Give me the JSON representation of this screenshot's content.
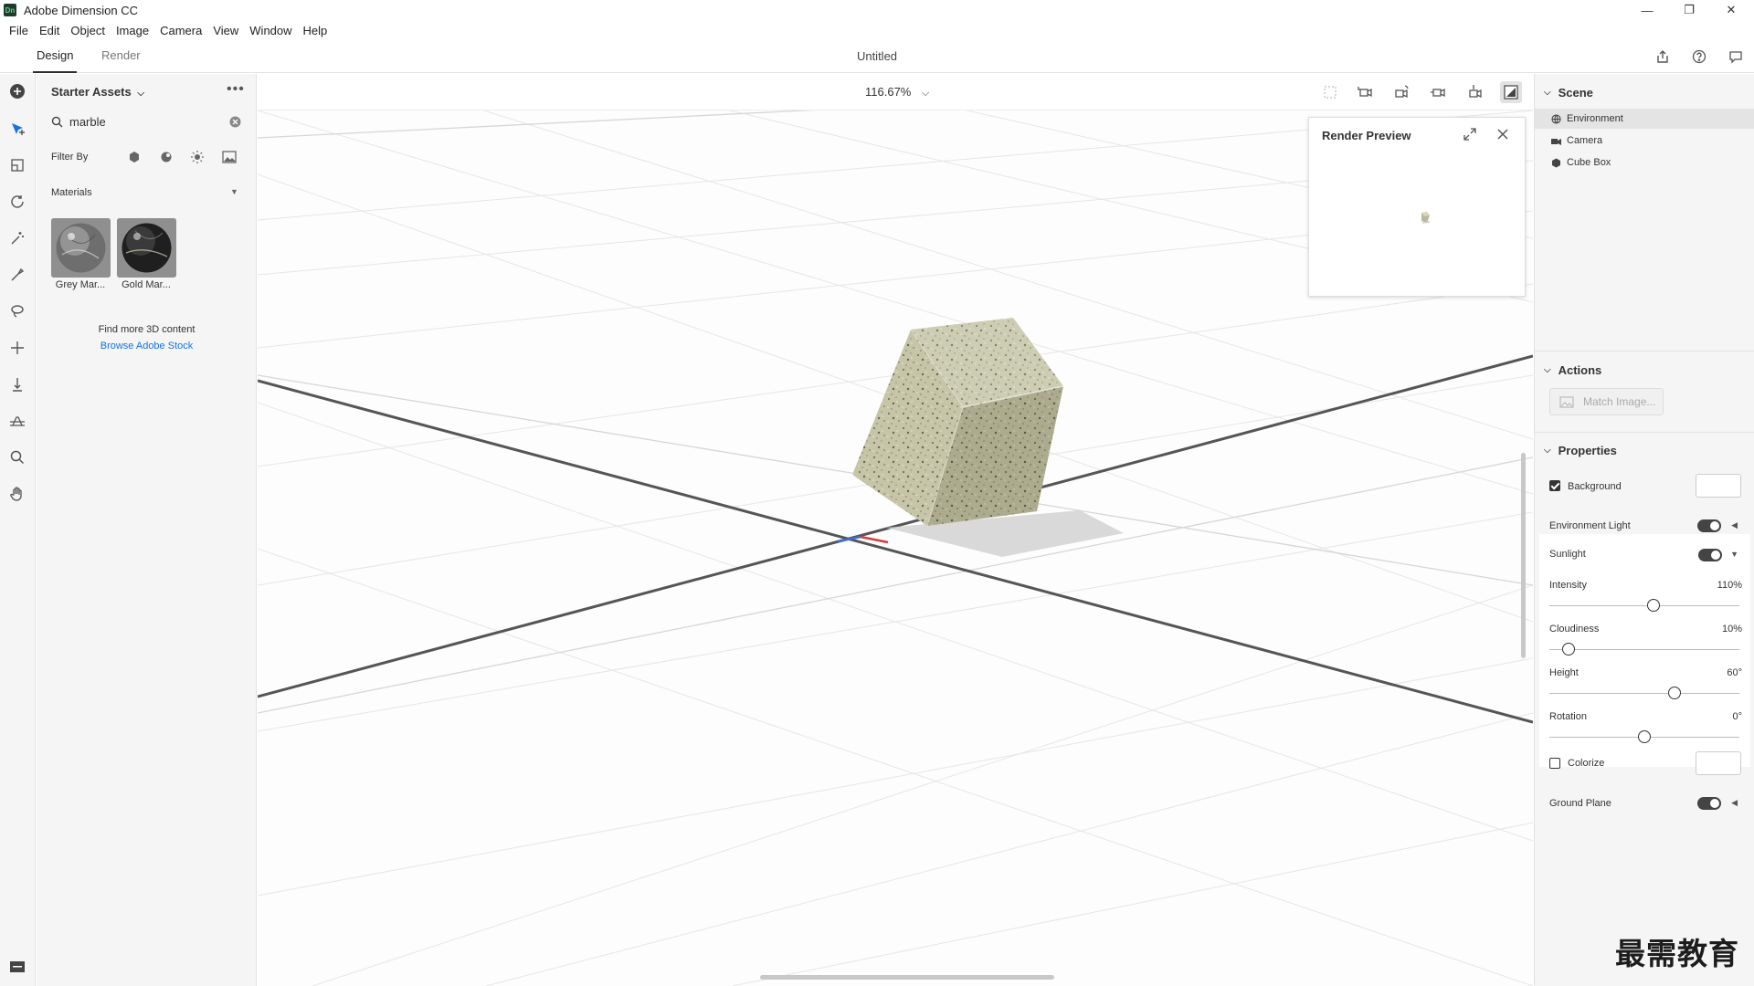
{
  "window": {
    "app_title": "Adobe Dimension CC",
    "logo_text": "Dn"
  },
  "menu": [
    "File",
    "Edit",
    "Object",
    "Image",
    "Camera",
    "View",
    "Window",
    "Help"
  ],
  "tabs": {
    "design": "Design",
    "render": "Render"
  },
  "document_title": "Untitled",
  "assets": {
    "header": "Starter Assets",
    "search_value": "marble",
    "filter_label": "Filter By",
    "section": "Materials",
    "items": [
      {
        "label": "Grey Mar..."
      },
      {
        "label": "Gold Mar..."
      }
    ],
    "find_more": "Find more 3D content",
    "browse_link": "Browse Adobe Stock"
  },
  "viewport": {
    "zoom": "116.67%"
  },
  "render_preview": {
    "title": "Render Preview"
  },
  "scene": {
    "header": "Scene",
    "items": [
      {
        "label": "Environment",
        "icon": "globe-icon"
      },
      {
        "label": "Camera",
        "icon": "camera-icon"
      },
      {
        "label": "Cube Box",
        "icon": "cube-icon"
      }
    ]
  },
  "actions": {
    "header": "Actions",
    "match_image": "Match Image..."
  },
  "properties": {
    "header": "Properties",
    "background_label": "Background",
    "environment_light_label": "Environment Light",
    "sunlight_label": "Sunlight",
    "intensity": {
      "label": "Intensity",
      "value": "110%",
      "level": 0.55
    },
    "cloudiness": {
      "label": "Cloudiness",
      "value": "10%",
      "level": 0.1
    },
    "height": {
      "label": "Height",
      "value": "60°",
      "level": 0.66
    },
    "rotation": {
      "label": "Rotation",
      "value": "0°",
      "level": 0.5
    },
    "colorize_label": "Colorize",
    "ground_plane_label": "Ground Plane"
  },
  "watermark": "最需教育"
}
